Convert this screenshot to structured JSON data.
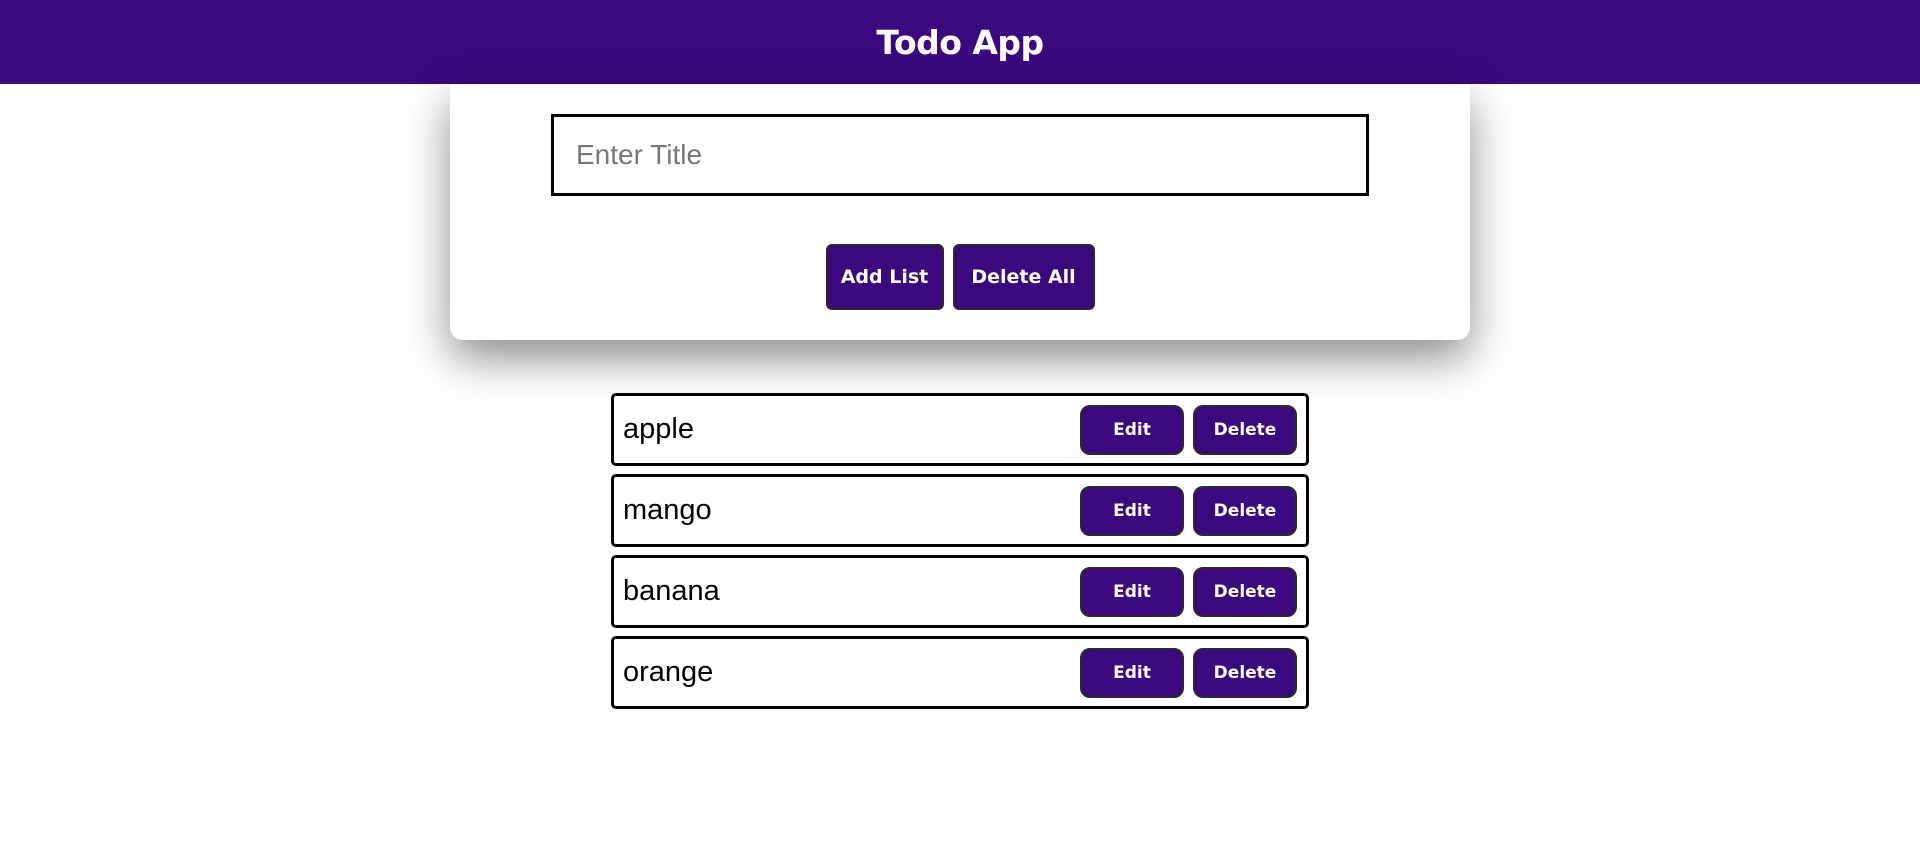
{
  "header": {
    "title": "Todo App"
  },
  "form": {
    "title_input": {
      "value": "",
      "placeholder": "Enter Title"
    },
    "add_label": "Add List",
    "delete_all_label": "Delete All"
  },
  "todos": [
    {
      "text": "apple",
      "edit_label": "Edit",
      "delete_label": "Delete"
    },
    {
      "text": "mango",
      "edit_label": "Edit",
      "delete_label": "Delete"
    },
    {
      "text": "banana",
      "edit_label": "Edit",
      "delete_label": "Delete"
    },
    {
      "text": "orange",
      "edit_label": "Edit",
      "delete_label": "Delete"
    }
  ],
  "colors": {
    "accent": "#3c087e",
    "background": "#ffffff",
    "border": "#000000"
  }
}
